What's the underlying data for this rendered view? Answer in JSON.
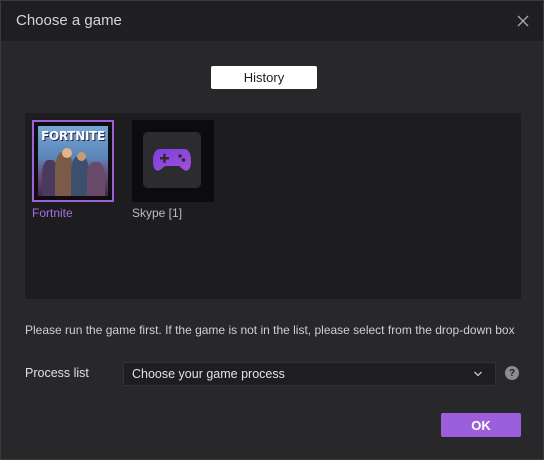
{
  "window": {
    "title": "Choose a game"
  },
  "history_button": {
    "label": "History"
  },
  "games": [
    {
      "name": "Fortnite",
      "selected": true,
      "thumbnail_text": "FORTNITE",
      "icon": "fortnite-cover"
    },
    {
      "name": "Skype [1]",
      "selected": false,
      "icon": "gamepad-icon"
    }
  ],
  "hint": {
    "text": "Please run the game first. If the game is not in the list, please select from the drop-down box"
  },
  "process": {
    "label": "Process list",
    "selected": "Choose your game process",
    "help": "?"
  },
  "ok_button": {
    "label": "OK"
  },
  "colors": {
    "accent": "#9c5fdb",
    "panel": "#1d1c1e",
    "background": "#282729"
  }
}
